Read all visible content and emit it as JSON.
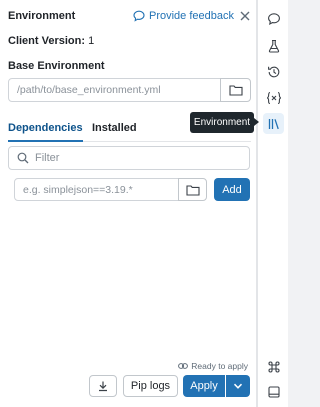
{
  "header": {
    "title": "Environment",
    "feedback_label": "Provide feedback"
  },
  "client_version": {
    "label": "Client Version:",
    "value": "1"
  },
  "base_environment": {
    "label": "Base Environment",
    "placeholder": "/path/to/base_environment.yml"
  },
  "tabs": [
    {
      "label": "Dependencies",
      "active": true
    },
    {
      "label": "Installed",
      "active": false
    }
  ],
  "filter": {
    "placeholder": "Filter"
  },
  "add_dependency": {
    "placeholder": "e.g. simplejson==3.19.*",
    "add_label": "Add"
  },
  "status": {
    "ready_label": "Ready to apply"
  },
  "footer": {
    "pip_logs_label": "Pip logs",
    "apply_label": "Apply"
  },
  "rail": {
    "tooltip": "Environment",
    "icons": [
      "comment-icon",
      "flask-icon",
      "history-icon",
      "variables-icon",
      "library-icon",
      "keyboard-shortcuts-icon",
      "panel-toggle-icon"
    ]
  },
  "colors": {
    "accent": "#2272b4",
    "tooltip_bg": "#1f272d",
    "border": "#d0d4d9"
  }
}
